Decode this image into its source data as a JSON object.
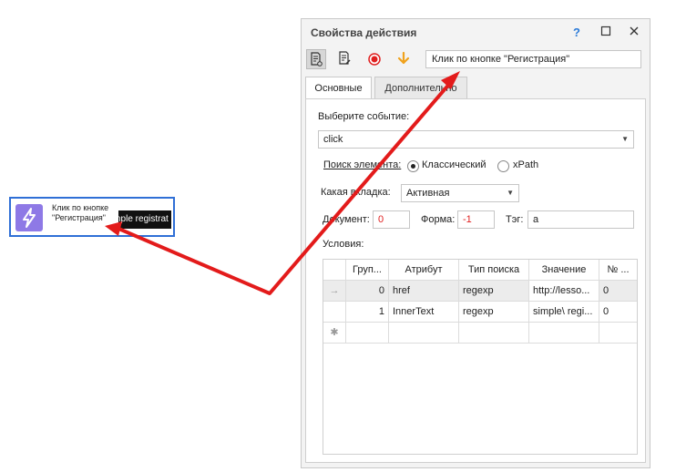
{
  "node": {
    "title": "Клик по кнопке \"Регистрация\"",
    "thumb_text": "imple registrat",
    "icon": "lightning-icon"
  },
  "dialog": {
    "title": "Свойства действия",
    "help": "?",
    "action_name": "Клик по кнопке \"Регистрация\"",
    "tabs": [
      "Основные",
      "Дополнительно"
    ],
    "event_label": "Выберите событие:",
    "event_value": "click",
    "search_label": "Поиск элемента:",
    "search_options": [
      "Классический",
      "xPath"
    ],
    "tab_label": "Какая вкладка:",
    "tab_value": "Активная",
    "document_label": "Документ:",
    "document_value": "0",
    "form_label": "Форма:",
    "form_value": "-1",
    "tag_label": "Тэг:",
    "tag_value": "a",
    "conditions_label": "Условия:",
    "columns": [
      "Груп...",
      "Атрибут",
      "Тип поиска",
      "Значение",
      "№ ..."
    ],
    "rows": [
      {
        "marker": "→",
        "group": "0",
        "attribute": "href",
        "search_type": "regexp",
        "value": "http://lesso...",
        "num": "0"
      },
      {
        "marker": "",
        "group": "1",
        "attribute": "InnerText",
        "search_type": "regexp",
        "value": "simple\\ regi...",
        "num": "0"
      }
    ],
    "new_row_marker": "✱"
  },
  "colors": {
    "arrow": "#e31b1b",
    "node_border": "#2f6fd6",
    "node_icon": "#8e79e6"
  }
}
